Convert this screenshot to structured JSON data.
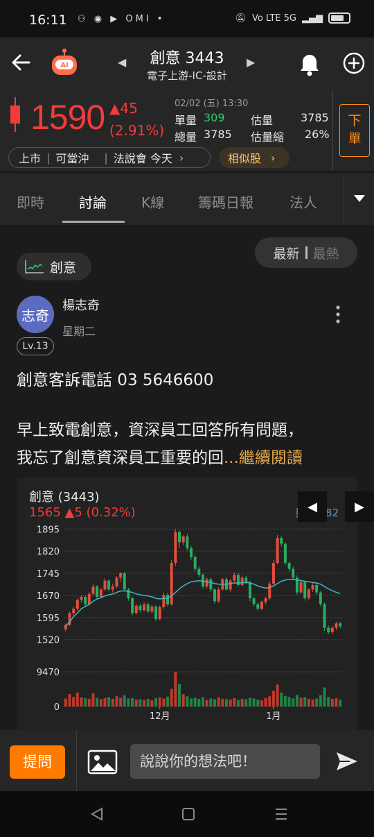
{
  "status_bar": {
    "time": "16:11",
    "notif_icons": "⚇ ◉ ▶ OMI •",
    "network": "Vo LTE 5G"
  },
  "header": {
    "title": "創意 3443",
    "subtitle": "電子上游-IC-設計"
  },
  "quote": {
    "price": "1590",
    "change": "▲45",
    "change_pct": "(2.91%)",
    "date": "02/02 (五) 13:30",
    "unit_volume_label": "單量",
    "unit_volume": "309",
    "est_volume_label": "估量",
    "est_volume": "3785",
    "total_volume_label": "總量",
    "total_volume": "3785",
    "est_shrink_label": "估量縮",
    "est_shrink": "26%",
    "order_button": [
      "下",
      "單"
    ],
    "listing": [
      "上市",
      "可當沖"
    ],
    "earnings_call": "法說會 今天",
    "similar_button": "相似股",
    "colors": {
      "up": "#f23b3b",
      "down": "#2ecc71",
      "accent": "#ff8c1a"
    }
  },
  "tabs": [
    "即時",
    "討論",
    "K線",
    "籌碼日報",
    "法人"
  ],
  "active_tab": "討論",
  "feed": {
    "sort": {
      "latest": "最新",
      "hot": "最熱"
    },
    "tag": "創意",
    "post": {
      "author": "楊志奇",
      "avatar_text": "志奇",
      "date": "星期二",
      "level": "Lv.13",
      "line1": "創意客訴電話 03 5646600",
      "line2": "早上致電創意，資深員工回答所有問題，",
      "line3": "我忘了創意資深員工重要的回",
      "read_more": "...繼續閱讀"
    },
    "chart_title": "創意 (3443)",
    "chart_quote": "1565 ▲5 (0.32%)",
    "chart_volume_text": "量: 3782"
  },
  "chart_data": {
    "type": "candlestick",
    "title": "創意 (3443)",
    "y_ticks": [
      1895,
      1820,
      1745,
      1670,
      1595,
      1520
    ],
    "ylim": [
      1505,
      1905
    ],
    "volume_ticks": [
      "9470",
      "0"
    ],
    "x_ticks": [
      "12月",
      "1月"
    ],
    "x_tick_index": [
      24,
      53
    ],
    "candles": [
      [
        1555,
        1570,
        1548,
        1575
      ],
      [
        1570,
        1610,
        1565,
        1615
      ],
      [
        1610,
        1625,
        1598,
        1632
      ],
      [
        1625,
        1655,
        1618,
        1660
      ],
      [
        1655,
        1665,
        1645,
        1672
      ],
      [
        1665,
        1640,
        1632,
        1670
      ],
      [
        1640,
        1675,
        1635,
        1682
      ],
      [
        1675,
        1700,
        1668,
        1708
      ],
      [
        1700,
        1665,
        1660,
        1705
      ],
      [
        1665,
        1690,
        1660,
        1695
      ],
      [
        1690,
        1720,
        1685,
        1728
      ],
      [
        1720,
        1690,
        1684,
        1725
      ],
      [
        1690,
        1700,
        1680,
        1710
      ],
      [
        1700,
        1730,
        1695,
        1735
      ],
      [
        1730,
        1745,
        1715,
        1750
      ],
      [
        1745,
        1690,
        1685,
        1750
      ],
      [
        1690,
        1660,
        1652,
        1695
      ],
      [
        1660,
        1610,
        1602,
        1665
      ],
      [
        1610,
        1635,
        1605,
        1640
      ],
      [
        1635,
        1620,
        1612,
        1642
      ],
      [
        1620,
        1640,
        1615,
        1646
      ],
      [
        1640,
        1615,
        1610,
        1645
      ],
      [
        1615,
        1632,
        1608,
        1638
      ],
      [
        1632,
        1590,
        1582,
        1636
      ],
      [
        1590,
        1630,
        1585,
        1636
      ],
      [
        1630,
        1672,
        1625,
        1680
      ],
      [
        1672,
        1640,
        1632,
        1678
      ],
      [
        1640,
        1780,
        1635,
        1790
      ],
      [
        1780,
        1885,
        1770,
        1895
      ],
      [
        1885,
        1850,
        1830,
        1890
      ],
      [
        1850,
        1870,
        1840,
        1875
      ],
      [
        1870,
        1830,
        1822,
        1878
      ],
      [
        1830,
        1800,
        1790,
        1838
      ],
      [
        1800,
        1760,
        1750,
        1808
      ],
      [
        1760,
        1740,
        1732,
        1768
      ],
      [
        1740,
        1700,
        1692,
        1745
      ],
      [
        1700,
        1725,
        1695,
        1732
      ],
      [
        1725,
        1690,
        1682,
        1730
      ],
      [
        1690,
        1650,
        1642,
        1695
      ],
      [
        1650,
        1690,
        1645,
        1698
      ],
      [
        1690,
        1725,
        1685,
        1730
      ],
      [
        1725,
        1690,
        1685,
        1732
      ],
      [
        1690,
        1720,
        1682,
        1726
      ],
      [
        1720,
        1740,
        1712,
        1748
      ],
      [
        1740,
        1705,
        1700,
        1745
      ],
      [
        1705,
        1730,
        1700,
        1738
      ],
      [
        1730,
        1715,
        1708,
        1736
      ],
      [
        1715,
        1660,
        1650,
        1720
      ],
      [
        1660,
        1640,
        1632,
        1665
      ],
      [
        1640,
        1625,
        1618,
        1646
      ],
      [
        1625,
        1648,
        1620,
        1652
      ],
      [
        1648,
        1660,
        1640,
        1665
      ],
      [
        1660,
        1710,
        1655,
        1718
      ],
      [
        1710,
        1780,
        1705,
        1790
      ],
      [
        1780,
        1865,
        1775,
        1875
      ],
      [
        1865,
        1845,
        1835,
        1872
      ],
      [
        1845,
        1780,
        1772,
        1850
      ],
      [
        1780,
        1760,
        1750,
        1785
      ],
      [
        1760,
        1730,
        1722,
        1768
      ],
      [
        1730,
        1680,
        1672,
        1738
      ],
      [
        1680,
        1715,
        1675,
        1722
      ],
      [
        1715,
        1660,
        1652,
        1720
      ],
      [
        1660,
        1690,
        1655,
        1695
      ],
      [
        1690,
        1705,
        1682,
        1712
      ],
      [
        1705,
        1680,
        1672,
        1710
      ],
      [
        1680,
        1640,
        1632,
        1685
      ],
      [
        1640,
        1560,
        1550,
        1645
      ],
      [
        1560,
        1545,
        1538,
        1568
      ],
      [
        1545,
        1560,
        1540,
        1565
      ],
      [
        1560,
        1575,
        1552,
        1580
      ],
      [
        1575,
        1565,
        1558,
        1580
      ]
    ],
    "ma": [
      1565,
      1580,
      1598,
      1610,
      1625,
      1632,
      1640,
      1650,
      1658,
      1662,
      1668,
      1672,
      1675,
      1680,
      1685,
      1685,
      1683,
      1680,
      1675,
      1672,
      1670,
      1668,
      1665,
      1660,
      1658,
      1660,
      1660,
      1668,
      1680,
      1692,
      1702,
      1710,
      1716,
      1718,
      1720,
      1718,
      1716,
      1714,
      1710,
      1708,
      1708,
      1708,
      1710,
      1712,
      1712,
      1713,
      1714,
      1712,
      1708,
      1702,
      1698,
      1695,
      1697,
      1702,
      1710,
      1718,
      1722,
      1724,
      1724,
      1722,
      1720,
      1718,
      1716,
      1714,
      1712,
      1708,
      1700,
      1692,
      1686,
      1680,
      1676
    ],
    "volumes": [
      2200,
      3400,
      2600,
      3800,
      2500,
      2300,
      2100,
      3600,
      2400,
      2000,
      2300,
      2600,
      2100,
      2800,
      2400,
      3100,
      2200,
      2300,
      1900,
      2000,
      1800,
      2100,
      1700,
      2300,
      2500,
      2200,
      2700,
      4800,
      9470,
      6200,
      3400,
      2800,
      2200,
      2400,
      2100,
      2600,
      1800,
      2200,
      2000,
      2500,
      2100,
      2000,
      1900,
      2300,
      1800,
      2100,
      2000,
      2400,
      2200,
      1900,
      1700,
      2300,
      2800,
      4300,
      6000,
      3800,
      2900,
      2600,
      2200,
      3200,
      2400,
      2600,
      2100,
      1900,
      2200,
      3100,
      5200,
      2600,
      2100,
      2300,
      1900
    ]
  },
  "composer": {
    "ask_button": "提問",
    "placeholder": "說說你的想法吧！"
  }
}
